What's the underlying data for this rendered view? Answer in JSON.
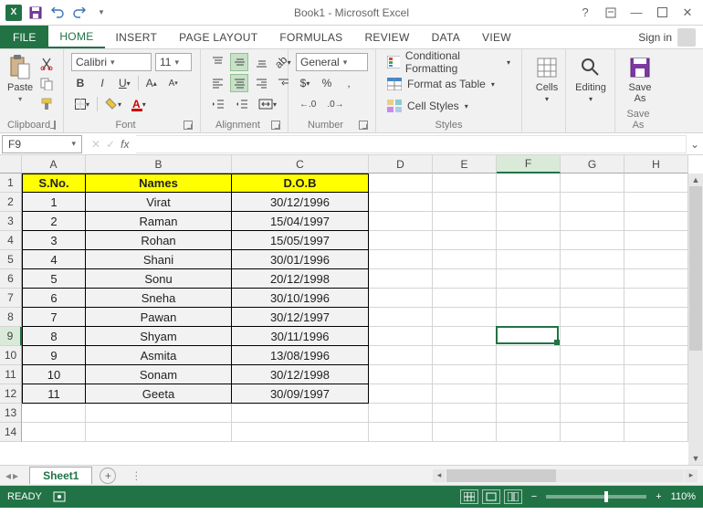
{
  "title": "Book1 - Microsoft Excel",
  "signin": "Sign in",
  "tabs": {
    "file": "FILE",
    "home": "HOME",
    "insert": "INSERT",
    "pagelayout": "PAGE LAYOUT",
    "formulas": "FORMULAS",
    "review": "REVIEW",
    "data": "DATA",
    "view": "VIEW"
  },
  "ribbon": {
    "clipboard": {
      "paste": "Paste",
      "label": "Clipboard"
    },
    "font": {
      "name": "Calibri",
      "size": "11",
      "label": "Font"
    },
    "alignment": {
      "label": "Alignment"
    },
    "number": {
      "format": "General",
      "label": "Number",
      "currency": "$",
      "percent": "%",
      "comma": ",",
      "dec_inc": ".0₀",
      "dec_dec": ".0⁰"
    },
    "styles": {
      "cond": "Conditional Formatting",
      "table": "Format as Table",
      "cell": "Cell Styles",
      "label": "Styles"
    },
    "cells": {
      "label": "Cells"
    },
    "editing": {
      "label": "Editing"
    },
    "saveas": {
      "btn": "Save As",
      "label": "Save As"
    }
  },
  "name_box": "F9",
  "columns": [
    "A",
    "B",
    "C",
    "D",
    "E",
    "F",
    "G",
    "H"
  ],
  "sheet": {
    "headers": {
      "sno": "S.No.",
      "names": "Names",
      "dob": "D.O.B"
    },
    "rows": [
      {
        "sno": "1",
        "name": "Virat",
        "dob": "30/12/1996"
      },
      {
        "sno": "2",
        "name": "Raman",
        "dob": "15/04/1997"
      },
      {
        "sno": "3",
        "name": "Rohan",
        "dob": "15/05/1997"
      },
      {
        "sno": "4",
        "name": "Shani",
        "dob": "30/01/1996"
      },
      {
        "sno": "5",
        "name": "Sonu",
        "dob": "20/12/1998"
      },
      {
        "sno": "6",
        "name": "Sneha",
        "dob": "30/10/1996"
      },
      {
        "sno": "7",
        "name": "Pawan",
        "dob": "30/12/1997"
      },
      {
        "sno": "8",
        "name": "Shyam",
        "dob": "30/11/1996"
      },
      {
        "sno": "9",
        "name": "Asmita",
        "dob": "13/08/1996"
      },
      {
        "sno": "10",
        "name": "Sonam",
        "dob": "30/12/1998"
      },
      {
        "sno": "11",
        "name": "Geeta",
        "dob": "30/09/1997"
      }
    ]
  },
  "sheet_tab": "Sheet1",
  "status": {
    "ready": "READY",
    "zoom": "110%"
  },
  "active_cell": {
    "col": "F",
    "row": 9
  }
}
